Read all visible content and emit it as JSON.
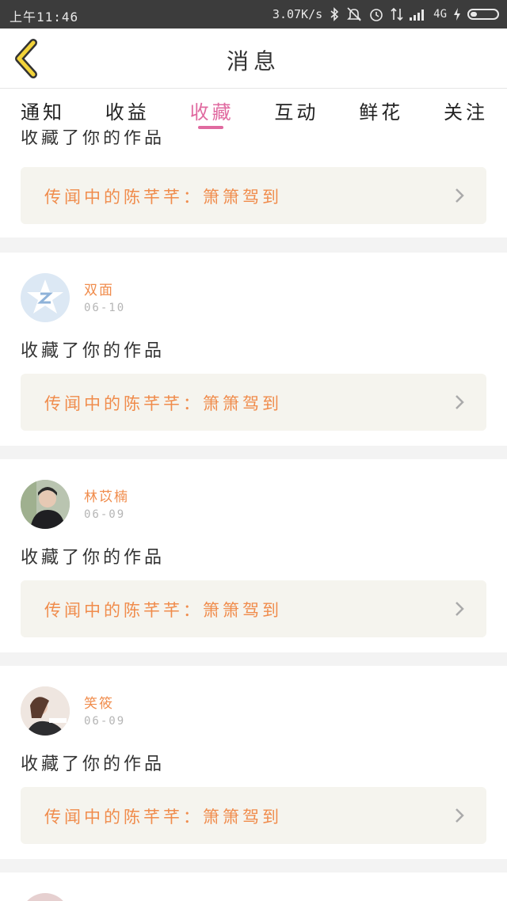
{
  "status_bar": {
    "time": "上午11:46",
    "speed": "3.07K/s",
    "network": "4G",
    "icons": [
      "bluetooth-icon",
      "mute-icon",
      "alarm-icon",
      "data-icon",
      "signal-icon",
      "charging-icon",
      "battery-icon"
    ]
  },
  "header": {
    "title": "消息",
    "back_icon": "chevron-left-icon"
  },
  "tabs": [
    {
      "label": "通知",
      "active": false
    },
    {
      "label": "收益",
      "active": false
    },
    {
      "label": "收藏",
      "active": true
    },
    {
      "label": "互动",
      "active": false
    },
    {
      "label": "鲜花",
      "active": false
    },
    {
      "label": "关注",
      "active": false
    }
  ],
  "feed": {
    "partial_top": {
      "action": "收藏了你的作品",
      "reference": "传闻中的陈芊芊：箫箫驾到"
    },
    "items": [
      {
        "username": "双面",
        "date": "06-10",
        "action": "收藏了你的作品",
        "reference": "传闻中的陈芊芊：箫箫驾到",
        "avatar": "default-avatar-icon"
      },
      {
        "username": "林苡楠",
        "date": "06-09",
        "action": "收藏了你的作品",
        "reference": "传闻中的陈芊芊：箫箫驾到",
        "avatar": "user-photo"
      },
      {
        "username": "笑筱",
        "date": "06-09",
        "action": "收藏了你的作品",
        "reference": "传闻中的陈芊芊：箫箫驾到",
        "avatar": "user-photo"
      }
    ]
  },
  "colors": {
    "accent": "#e06aa0",
    "username": "#f08c4c",
    "reference_bg": "#f5f4ee",
    "back_icon": "#f2d33a"
  }
}
